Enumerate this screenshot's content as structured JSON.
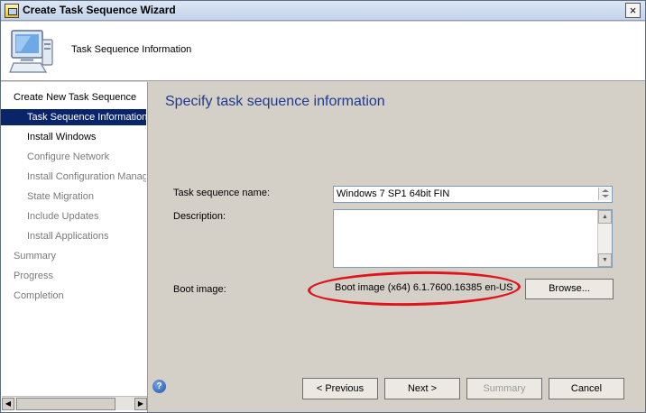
{
  "window": {
    "title": "Create Task Sequence Wizard",
    "close_glyph": "×"
  },
  "header": {
    "text": "Task Sequence Information",
    "icon": "computer-icon"
  },
  "nav": {
    "items": [
      {
        "label": "Create New Task Sequence",
        "level": 0,
        "state": "normal"
      },
      {
        "label": "Task Sequence Information",
        "level": 1,
        "state": "selected"
      },
      {
        "label": "Install Windows",
        "level": 1,
        "state": "normal"
      },
      {
        "label": "Configure Network",
        "level": 1,
        "state": "dim"
      },
      {
        "label": "Install Configuration Manag",
        "level": 1,
        "state": "dim"
      },
      {
        "label": "State Migration",
        "level": 1,
        "state": "dim"
      },
      {
        "label": "Include Updates",
        "level": 1,
        "state": "dim"
      },
      {
        "label": "Install Applications",
        "level": 1,
        "state": "dim"
      },
      {
        "label": "Summary",
        "level": 0,
        "state": "dim"
      },
      {
        "label": "Progress",
        "level": 0,
        "state": "dim"
      },
      {
        "label": "Completion",
        "level": 0,
        "state": "dim"
      }
    ],
    "scroll_left": "◀",
    "scroll_right": "▶"
  },
  "main": {
    "title": "Specify task sequence information",
    "name_label": "Task sequence name:",
    "name_value": "Windows 7 SP1 64bit FIN",
    "description_label": "Description:",
    "description_value": "",
    "boot_label": "Boot image:",
    "boot_value": "Boot image (x64) 6.1.7600.16385 en-US",
    "browse_label": "Browse..."
  },
  "footer": {
    "help_glyph": "?",
    "previous_label": "< Previous",
    "next_label": "Next >",
    "summary_label": "Summary",
    "cancel_label": "Cancel"
  },
  "colors": {
    "selection": "#0a246a",
    "title_accent": "#1f3a93",
    "highlight_ellipse": "#e0141b"
  }
}
